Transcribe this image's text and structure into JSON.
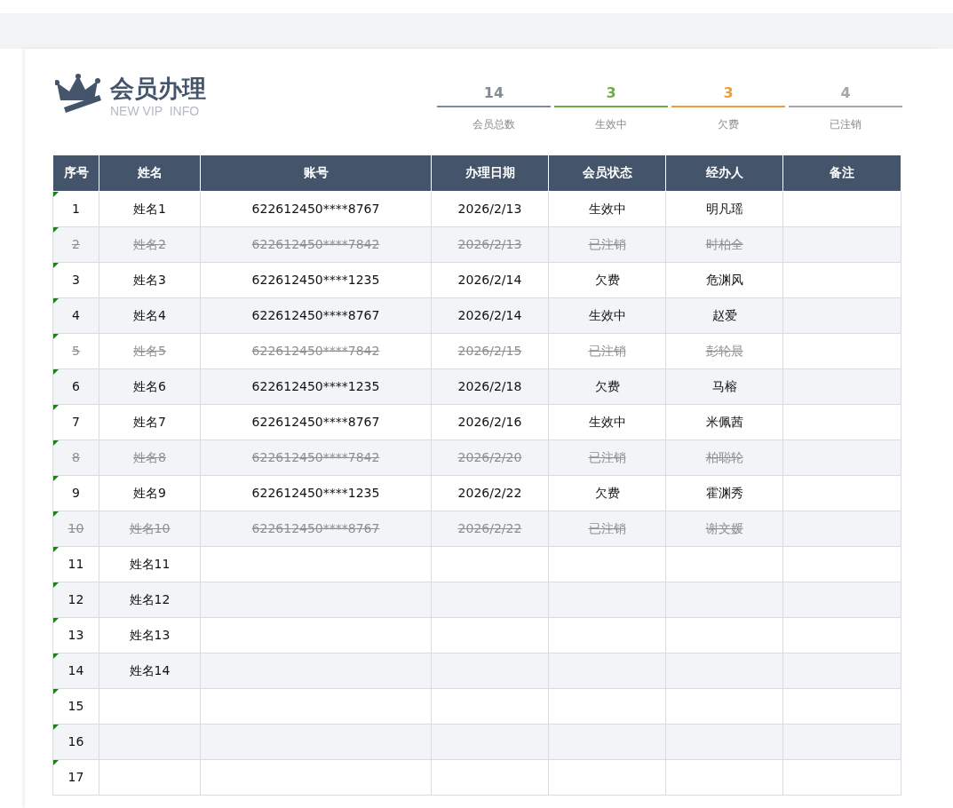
{
  "header": {
    "title": "会员办理",
    "subtitle": "NEW VIP  INFO"
  },
  "stats": [
    {
      "value": "14",
      "label": "会员总数",
      "color": "#7f8c9a"
    },
    {
      "value": "3",
      "label": "生效中",
      "color": "#70ad47"
    },
    {
      "value": "3",
      "label": "欠费",
      "color": "#ed9d3c"
    },
    {
      "value": "4",
      "label": "已注销",
      "color": "#a6a6a6"
    }
  ],
  "table": {
    "columns": [
      "序号",
      "姓名",
      "账号",
      "办理日期",
      "会员状态",
      "经办人",
      "备注"
    ],
    "rows": [
      {
        "no": "1",
        "name": "姓名1",
        "account": "622612450****8767",
        "date": "2026/2/13",
        "status": "生效中",
        "handler": "明凡瑶",
        "cancelled": false
      },
      {
        "no": "2",
        "name": "姓名2",
        "account": "622612450****7842",
        "date": "2026/2/13",
        "status": "已注销",
        "handler": "时柏全",
        "cancelled": true
      },
      {
        "no": "3",
        "name": "姓名3",
        "account": "622612450****1235",
        "date": "2026/2/14",
        "status": "欠费",
        "handler": "危渊风",
        "cancelled": false
      },
      {
        "no": "4",
        "name": "姓名4",
        "account": "622612450****8767",
        "date": "2026/2/14",
        "status": "生效中",
        "handler": "赵爱",
        "cancelled": false
      },
      {
        "no": "5",
        "name": "姓名5",
        "account": "622612450****7842",
        "date": "2026/2/15",
        "status": "已注销",
        "handler": "彭轮晨",
        "cancelled": true
      },
      {
        "no": "6",
        "name": "姓名6",
        "account": "622612450****1235",
        "date": "2026/2/18",
        "status": "欠费",
        "handler": "马榕",
        "cancelled": false
      },
      {
        "no": "7",
        "name": "姓名7",
        "account": "622612450****8767",
        "date": "2026/2/16",
        "status": "生效中",
        "handler": "米佩茜",
        "cancelled": false
      },
      {
        "no": "8",
        "name": "姓名8",
        "account": "622612450****7842",
        "date": "2026/2/20",
        "status": "已注销",
        "handler": "柏聪轮",
        "cancelled": true
      },
      {
        "no": "9",
        "name": "姓名9",
        "account": "622612450****1235",
        "date": "2026/2/22",
        "status": "欠费",
        "handler": "霍渊秀",
        "cancelled": false
      },
      {
        "no": "10",
        "name": "姓名10",
        "account": "622612450****8767",
        "date": "2026/2/22",
        "status": "已注销",
        "handler": "谢文媛",
        "cancelled": true
      },
      {
        "no": "11",
        "name": "姓名11",
        "cancelled": false
      },
      {
        "no": "12",
        "name": "姓名12",
        "cancelled": false
      },
      {
        "no": "13",
        "name": "姓名13",
        "cancelled": false
      },
      {
        "no": "14",
        "name": "姓名14",
        "cancelled": false
      },
      {
        "no": "15",
        "cancelled": false
      },
      {
        "no": "16",
        "cancelled": false
      },
      {
        "no": "17",
        "cancelled": false
      }
    ]
  }
}
